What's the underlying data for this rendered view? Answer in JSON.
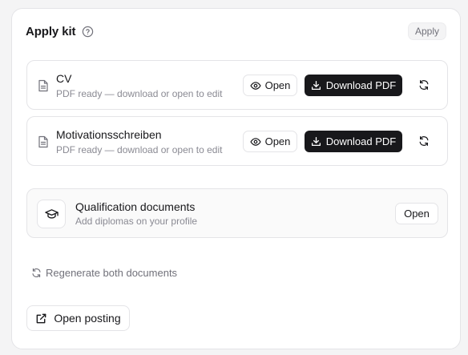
{
  "panel": {
    "title": "Apply kit",
    "help_icon": "help-circle-icon",
    "apply_label": "Apply"
  },
  "documents": [
    {
      "name": "CV",
      "status": "PDF ready — download or open to edit",
      "icon": "file-text-icon",
      "open_label": "Open",
      "download_label": "Download PDF"
    },
    {
      "name": "Motivationsschreiben",
      "status": "PDF ready — download or open to edit",
      "icon": "file-text-icon",
      "open_label": "Open",
      "download_label": "Download PDF"
    }
  ],
  "qualifications": {
    "title": "Qualification documents",
    "subtitle": "Add diplomas on your profile",
    "icon": "graduation-cap-icon",
    "open_label": "Open"
  },
  "actions": {
    "regenerate_label": "Regenerate both documents",
    "open_posting_label": "Open posting"
  },
  "colors": {
    "primary_button": "#18181b",
    "muted_text": "#8a8a93",
    "border": "#e4e4e7"
  }
}
